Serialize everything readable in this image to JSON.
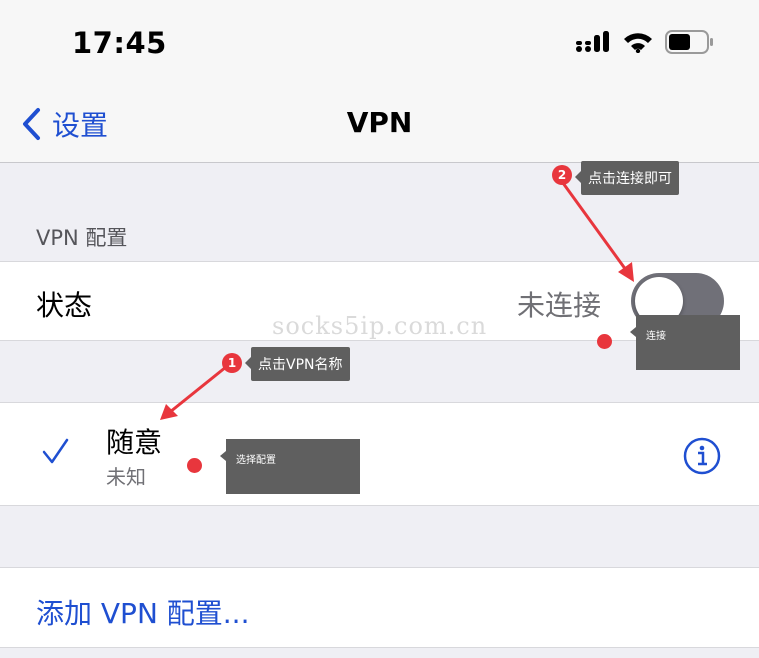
{
  "status_bar": {
    "time": "17:45",
    "icons": [
      "signal-icon",
      "wifi-icon",
      "battery-icon"
    ]
  },
  "nav": {
    "back_label": "设置",
    "title": "VPN"
  },
  "section": {
    "header": "VPN 配置"
  },
  "status_row": {
    "label": "状态",
    "value": "未连接",
    "toggle_on": false
  },
  "vpn_item": {
    "name": "随意",
    "subtitle": "未知",
    "selected": true
  },
  "add_row": {
    "label": "添加 VPN 配置..."
  },
  "watermark": "socks5ip.com.cn",
  "annotations": {
    "step1": {
      "number": "1",
      "text": "点击VPN名称"
    },
    "step2": {
      "number": "2",
      "text": "点击连接即可"
    },
    "note_select": "选择配置",
    "note_connect": "连接"
  },
  "colors": {
    "accent": "#1f4fd1",
    "annotation_red": "#e8363d",
    "tooltip_bg": "#5f5f5f",
    "toggle_off": "#707078"
  }
}
